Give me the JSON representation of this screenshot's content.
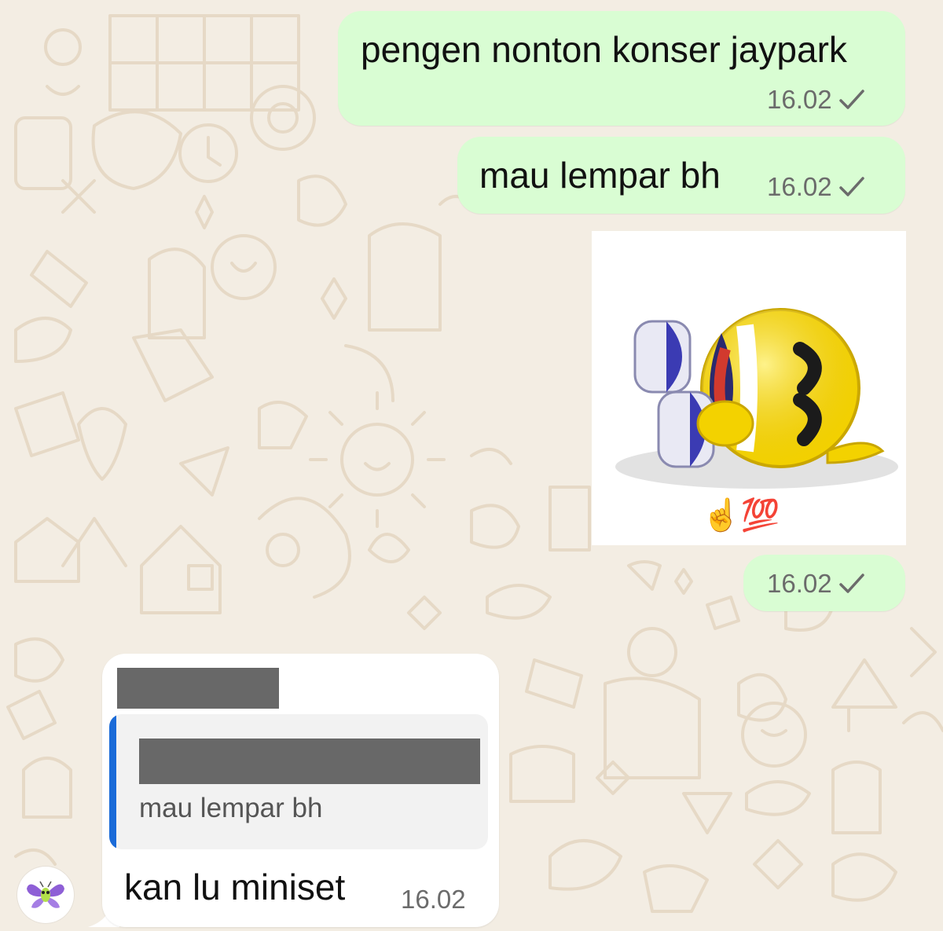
{
  "chat": {
    "messages_out": [
      {
        "text": "pengen nonton konser jaypark",
        "time": "16.02",
        "status": "sent-check-icon"
      },
      {
        "text": "mau lempar bh",
        "time": "16.02",
        "status": "sent-check-icon"
      },
      {
        "type": "sticker",
        "sticker_desc": "laughing-rolling-emoji-sticker",
        "emoji": "☝️💯",
        "time": "16.02",
        "status": "sent-check-icon"
      }
    ],
    "message_in": {
      "quoted_text": "mau lempar bh",
      "text": "kan lu miniset",
      "time": "16.02"
    },
    "avatar_icon": "butterfly-icon"
  },
  "colors": {
    "background": "#f3ede3",
    "outgoing_bubble": "#d9fdd3",
    "incoming_bubble": "#ffffff",
    "quote_accent": "#1b6bd8",
    "redaction": "#686868"
  }
}
